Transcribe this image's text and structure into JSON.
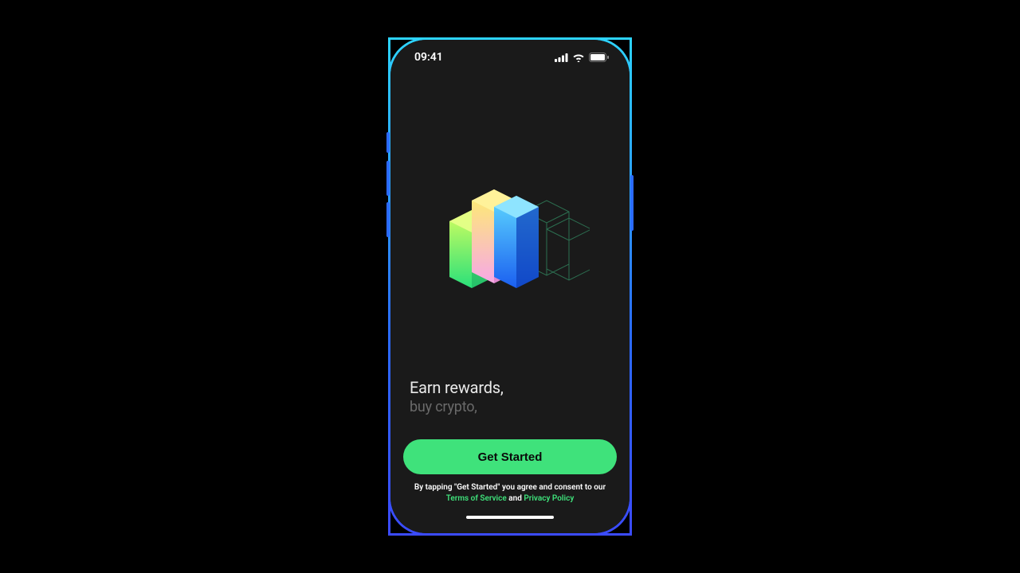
{
  "status": {
    "time": "09:41"
  },
  "headlines": {
    "primary": "Earn rewards,",
    "secondary": "buy crypto,"
  },
  "cta": {
    "label": "Get Started"
  },
  "consent": {
    "prefix": "By tapping \"Get Started\" you agree and consent to our",
    "terms_label": "Terms of Service",
    "and": " and ",
    "privacy_label": "Privacy Policy"
  },
  "colors": {
    "accent": "#3fe27b",
    "frame_top": "#2dd4ff",
    "frame_bottom": "#3b4bff",
    "bg": "#1a1a1a"
  }
}
